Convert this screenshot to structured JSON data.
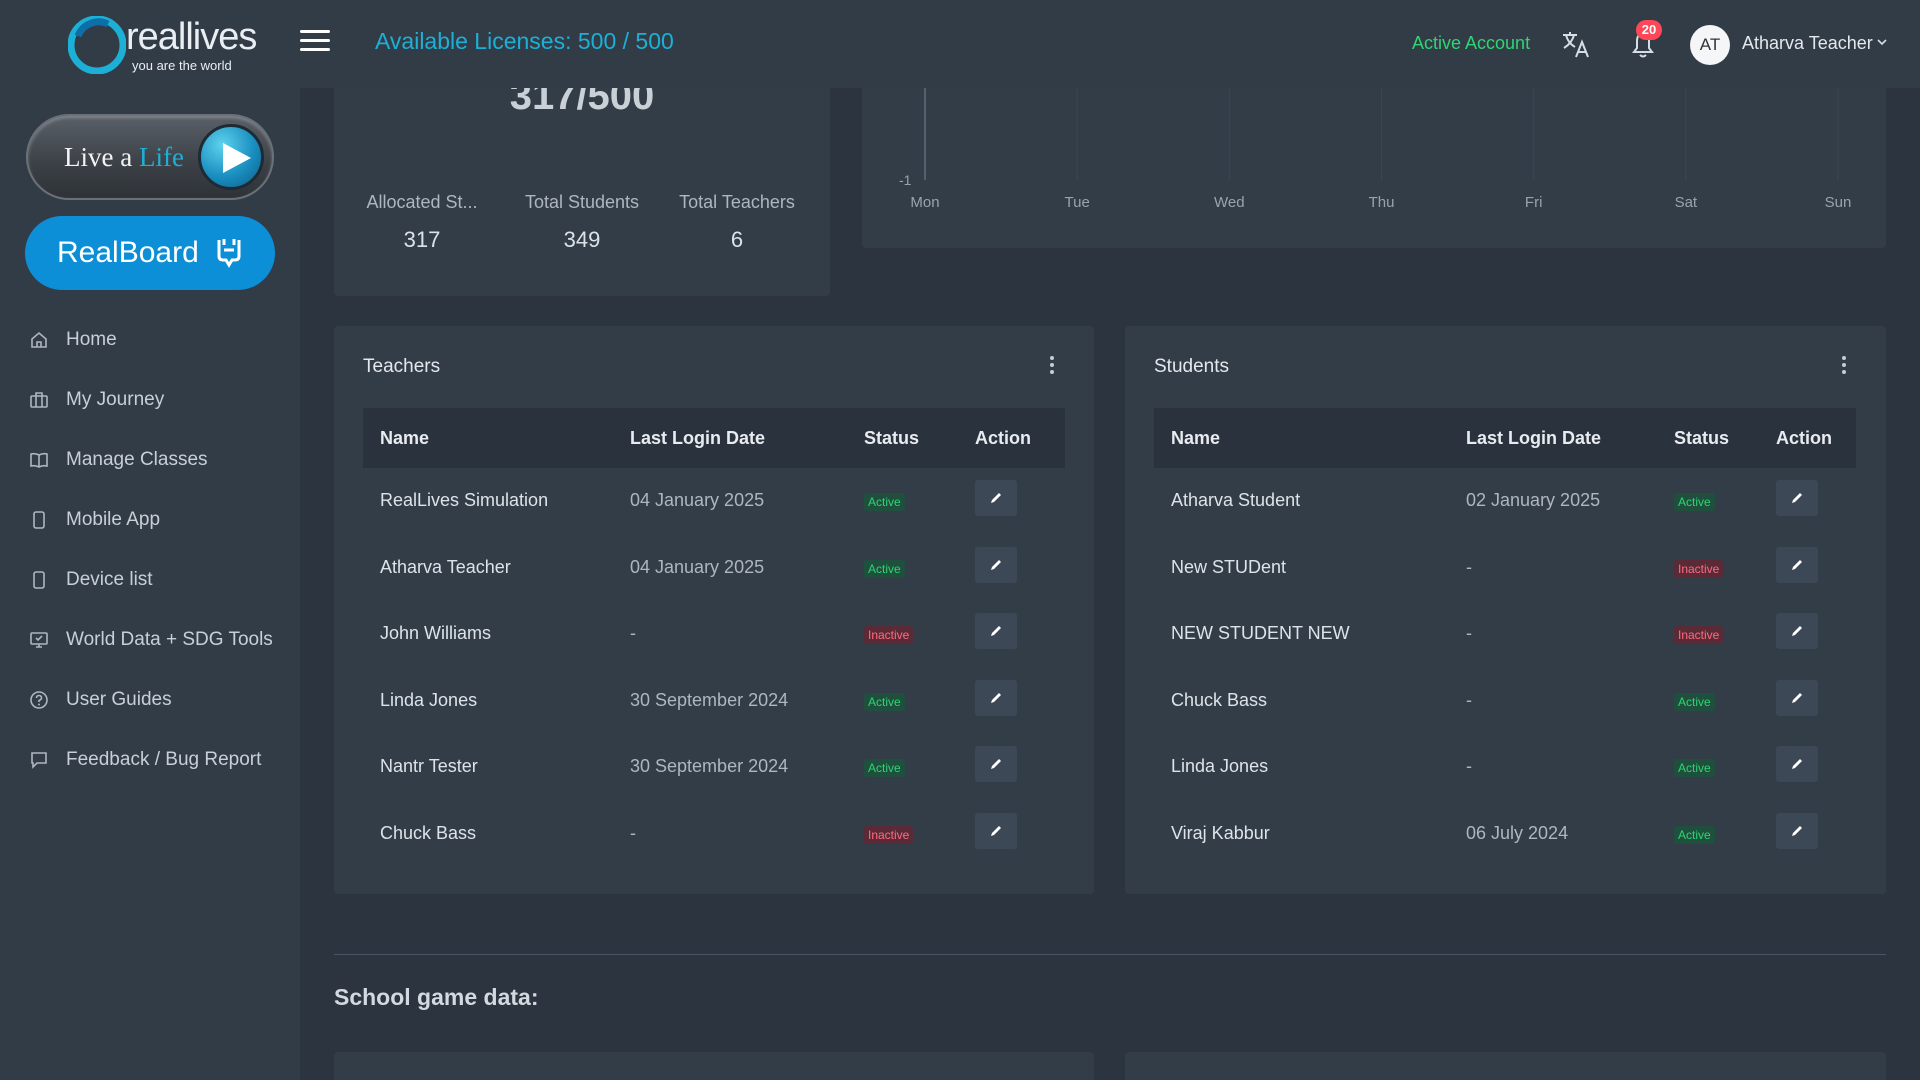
{
  "brand": {
    "name": "reallives",
    "tagline": "you are the world"
  },
  "sidebar": {
    "live_btn": {
      "text_a": "Live a ",
      "text_b": "Life"
    },
    "realboard_label": "RealBoard",
    "items": [
      {
        "label": "Home",
        "icon": "home-icon"
      },
      {
        "label": "My Journey",
        "icon": "briefcase-icon"
      },
      {
        "label": "Manage Classes",
        "icon": "book-icon"
      },
      {
        "label": "Mobile App",
        "icon": "phone-icon"
      },
      {
        "label": "Device list",
        "icon": "device-icon"
      },
      {
        "label": "World Data + SDG Tools",
        "icon": "monitor-icon"
      },
      {
        "label": "User Guides",
        "icon": "help-circle-icon"
      },
      {
        "label": "Feedback / Bug Report",
        "icon": "message-icon"
      }
    ]
  },
  "topbar": {
    "licenses": "Available Licenses: 500 / 500",
    "account_status": "Active Account",
    "notification_count": "20",
    "avatar_initials": "AT",
    "user_name": "Atharva Teacher"
  },
  "stats": {
    "big_value": "317/500",
    "items": [
      {
        "label": "Allocated St...",
        "value": "317"
      },
      {
        "label": "Total Students",
        "value": "349"
      },
      {
        "label": "Total Teachers",
        "value": "6"
      }
    ]
  },
  "chart_data": {
    "type": "line",
    "categories": [
      "Mon",
      "Tue",
      "Wed",
      "Thu",
      "Fri",
      "Sat",
      "Sun"
    ],
    "y_tick_labels": [
      "-1"
    ],
    "grid": true
  },
  "teachers": {
    "title": "Teachers",
    "columns": [
      "Name",
      "Last Login Date",
      "Status",
      "Action"
    ],
    "rows": [
      {
        "name": "RealLives Simulation",
        "date": "04 January 2025",
        "status": "Active"
      },
      {
        "name": "Atharva Teacher",
        "date": "04 January 2025",
        "status": "Active"
      },
      {
        "name": "John Williams",
        "date": "-",
        "status": "Inactive"
      },
      {
        "name": "Linda Jones",
        "date": "30 September 2024",
        "status": "Active"
      },
      {
        "name": "Nantr Tester",
        "date": "30 September 2024",
        "status": "Active"
      },
      {
        "name": "Chuck Bass",
        "date": "-",
        "status": "Inactive"
      }
    ]
  },
  "students": {
    "title": "Students",
    "columns": [
      "Name",
      "Last Login Date",
      "Status",
      "Action"
    ],
    "rows": [
      {
        "name": "Atharva Student",
        "date": "02 January 2025",
        "status": "Active"
      },
      {
        "name": "New STUDent",
        "date": "-",
        "status": "Inactive"
      },
      {
        "name": "NEW STUDENT NEW",
        "date": "-",
        "status": "Inactive"
      },
      {
        "name": "Chuck Bass",
        "date": "-",
        "status": "Active"
      },
      {
        "name": "Linda Jones",
        "date": "-",
        "status": "Active"
      },
      {
        "name": "Viraj Kabbur",
        "date": "06 July 2024",
        "status": "Active"
      }
    ]
  },
  "section": {
    "title": "School game data:"
  }
}
